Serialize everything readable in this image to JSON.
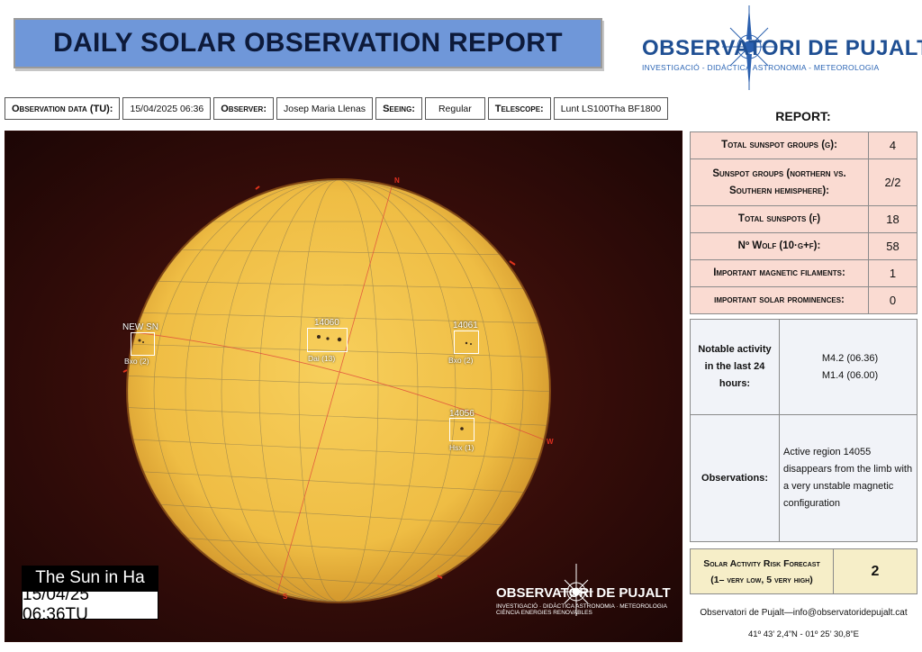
{
  "title": "DAILY SOLAR OBSERVATION REPORT",
  "logo": {
    "main": "OBSERVATORI DE PUJALT",
    "sub": "INVESTIGACIÓ - DIDÀCTICA        ASTRONOMIA - METEOROLOGIA"
  },
  "info": {
    "date_label": "Observation data (TU):",
    "date_value": "15/04/2025 06:36",
    "observer_label": "Observer:",
    "observer_value": "Josep Maria Llenas",
    "seeing_label": "Seeing:",
    "seeing_value": "Regular",
    "telescope_label": "Telescope:",
    "telescope_value": "Lunt LS100Tha BF1800"
  },
  "image": {
    "caption_title": "The Sun in Ha",
    "caption_date": "15/04/25 06:36TU",
    "watermark_main": "OBSERVATORI DE PUJALT",
    "watermark_sub1": "INVESTIGACIÓ · DIDÀCTICA        ASTRONOMIA · METEOROLOGIA",
    "watermark_sub2": "CIÈNCIA                                ENERGIES RENOVABLES",
    "regions": [
      {
        "label": "NEW SN",
        "sub": "Bxo (2)"
      },
      {
        "label": "14060",
        "sub": "Dai (13)"
      },
      {
        "label": "14061",
        "sub": "Bxo (2)"
      },
      {
        "label": "14056",
        "sub": "Hsx (1)"
      }
    ],
    "compass": {
      "n": "N",
      "s": "S",
      "w": "W"
    }
  },
  "report": {
    "heading": "REPORT:",
    "rows": [
      {
        "label": "Total sunspot groups (g):",
        "value": "4"
      },
      {
        "label": "Sunspot groups (northern vs. Southern hemisphere):",
        "value": "2/2"
      },
      {
        "label": "Total sunspots (f)",
        "value": "18"
      },
      {
        "label": "Nº Wolf (10·g+f):",
        "value": "58"
      },
      {
        "label": "Important magnetic filaments:",
        "value": "1"
      },
      {
        "label": "important solar prominences:",
        "value": "0"
      }
    ]
  },
  "activity": {
    "notable_label": "Notable activity in the last 24 hours:",
    "notable_1": "M4.2 (06.36)",
    "notable_2": "M1.4 (06.00)",
    "observations_label": "Observations:",
    "observations_text": "Active region 14055 disappears from the limb with a very unstable magnetic configuration"
  },
  "risk": {
    "label_1": "Solar Activity Risk Forecast",
    "label_2": "(1– very low, 5 very high)",
    "value": "2"
  },
  "footer": {
    "contact": "Observatori de Pujalt—info@observatoridepujalt.cat",
    "coords": "41º 43’ 2,4”N - 01º 25’ 30,8”E"
  },
  "colors": {
    "banner": "#6f97d9",
    "report_bg": "#fadbd2",
    "activity_bg": "#f1f3f8",
    "risk_bg": "#f6eec8",
    "sun": "#f3c24a"
  }
}
